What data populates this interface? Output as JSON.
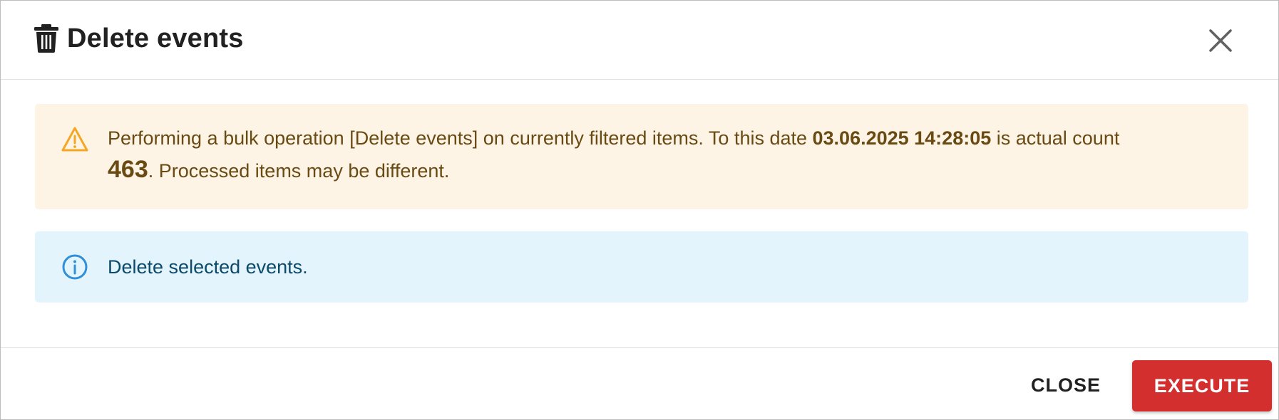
{
  "dialog": {
    "title": "Delete events",
    "title_icon": "trash-icon",
    "close_icon": "close-icon"
  },
  "warning": {
    "icon": "warning-triangle-icon",
    "text_before_date": "Performing a bulk operation [Delete events] on currently filtered items. To this date ",
    "date": "03.06.2025 14:28:05",
    "text_before_count": " is actual count ",
    "count": "463",
    "text_after_count": ". Processed items may be different."
  },
  "info": {
    "icon": "info-circle-icon",
    "text": "Delete selected events."
  },
  "footer": {
    "close_label": "CLOSE",
    "execute_label": "EXECUTE"
  },
  "colors": {
    "execute_button": "#d32f2f",
    "warning_background": "#fdf4e6",
    "warning_icon": "#f5a623",
    "info_background": "#e4f4fc",
    "info_icon": "#2f8fd8"
  }
}
